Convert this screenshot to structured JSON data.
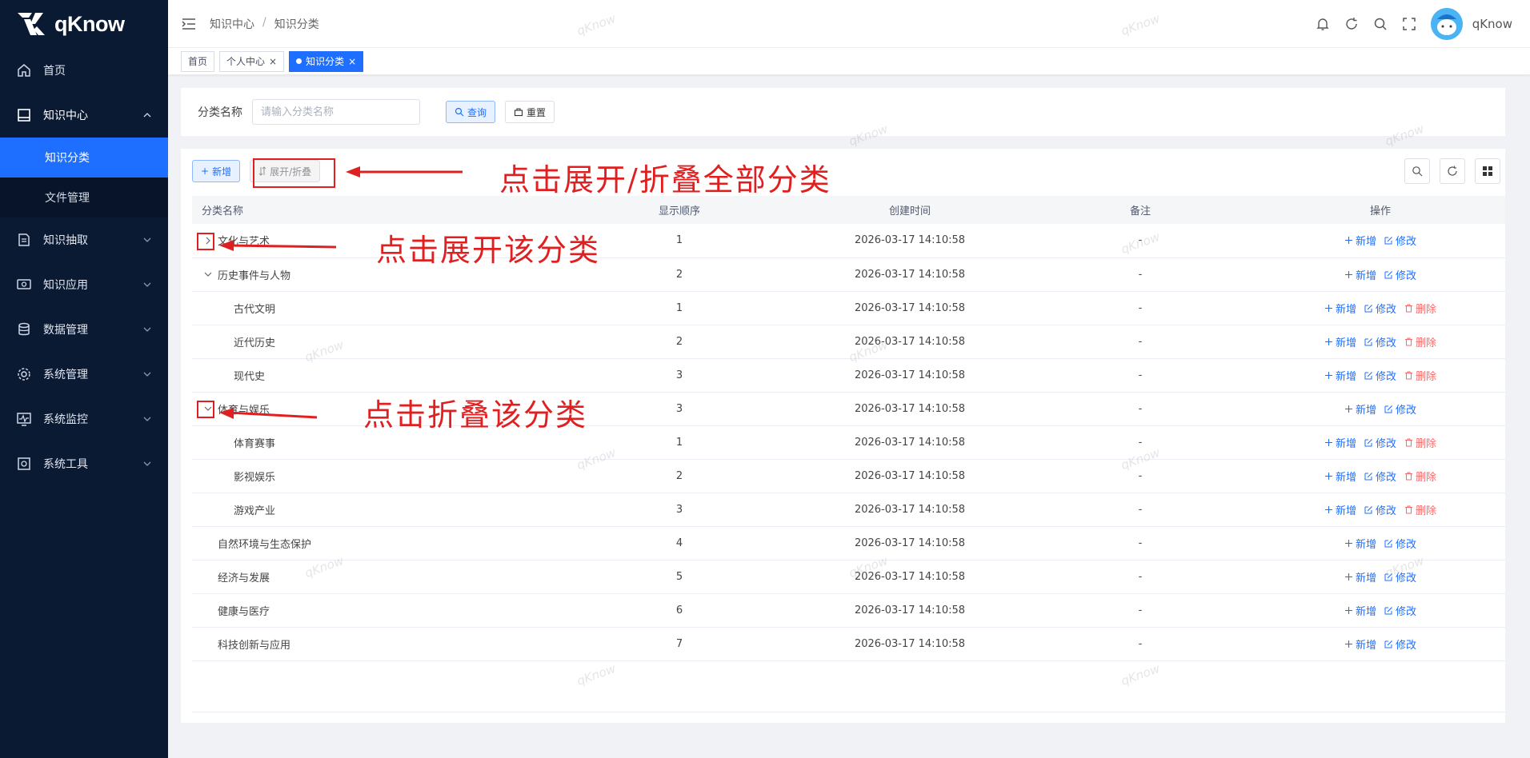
{
  "brand": {
    "name": "qKnow"
  },
  "sidebar": {
    "items": [
      {
        "label": "首页",
        "icon": "home-icon"
      },
      {
        "label": "知识中心",
        "icon": "book-icon",
        "open": true,
        "children": [
          {
            "label": "知识分类",
            "active": true
          },
          {
            "label": "文件管理"
          }
        ]
      },
      {
        "label": "知识抽取",
        "icon": "extract-icon"
      },
      {
        "label": "知识应用",
        "icon": "app-icon"
      },
      {
        "label": "数据管理",
        "icon": "database-icon"
      },
      {
        "label": "系统管理",
        "icon": "gear-icon"
      },
      {
        "label": "系统监控",
        "icon": "monitor-icon"
      },
      {
        "label": "系统工具",
        "icon": "tool-icon"
      }
    ]
  },
  "header": {
    "breadcrumb": [
      "知识中心",
      "知识分类"
    ],
    "user": "qKnow"
  },
  "tags": [
    {
      "label": "首页",
      "closable": false
    },
    {
      "label": "个人中心",
      "closable": true
    },
    {
      "label": "知识分类",
      "closable": true,
      "active": true
    }
  ],
  "search": {
    "label": "分类名称",
    "placeholder": "请输入分类名称",
    "query_label": "查询",
    "reset_label": "重置"
  },
  "toolbar": {
    "add_label": "新增",
    "toggle_label": "展开/折叠"
  },
  "table": {
    "columns": [
      "分类名称",
      "显示顺序",
      "创建时间",
      "备注",
      "操作"
    ],
    "ops": {
      "add": "新增",
      "edit": "修改",
      "del": "删除"
    },
    "rows": [
      {
        "name": "文化与艺术",
        "order": "1",
        "time": "2026-03-17 14:10:58",
        "remark": "-",
        "level": 0,
        "expander": "collapsed",
        "del": false
      },
      {
        "name": "历史事件与人物",
        "order": "2",
        "time": "2026-03-17 14:10:58",
        "remark": "-",
        "level": 0,
        "expander": "expanded",
        "del": false
      },
      {
        "name": "古代文明",
        "order": "1",
        "time": "2026-03-17 14:10:58",
        "remark": "-",
        "level": 1,
        "expander": "none",
        "del": true
      },
      {
        "name": "近代历史",
        "order": "2",
        "time": "2026-03-17 14:10:58",
        "remark": "-",
        "level": 1,
        "expander": "none",
        "del": true
      },
      {
        "name": "现代史",
        "order": "3",
        "time": "2026-03-17 14:10:58",
        "remark": "-",
        "level": 1,
        "expander": "none",
        "del": true
      },
      {
        "name": "体育与娱乐",
        "order": "3",
        "time": "2026-03-17 14:10:58",
        "remark": "-",
        "level": 0,
        "expander": "expanded",
        "del": false
      },
      {
        "name": "体育赛事",
        "order": "1",
        "time": "2026-03-17 14:10:58",
        "remark": "-",
        "level": 1,
        "expander": "none",
        "del": true
      },
      {
        "name": "影视娱乐",
        "order": "2",
        "time": "2026-03-17 14:10:58",
        "remark": "-",
        "level": 1,
        "expander": "none",
        "del": true
      },
      {
        "name": "游戏产业",
        "order": "3",
        "time": "2026-03-17 14:10:58",
        "remark": "-",
        "level": 1,
        "expander": "none",
        "del": true
      },
      {
        "name": "自然环境与生态保护",
        "order": "4",
        "time": "2026-03-17 14:10:58",
        "remark": "-",
        "level": 0,
        "expander": "leaf",
        "del": false
      },
      {
        "name": "经济与发展",
        "order": "5",
        "time": "2026-03-17 14:10:58",
        "remark": "-",
        "level": 0,
        "expander": "leaf",
        "del": false
      },
      {
        "name": "健康与医疗",
        "order": "6",
        "time": "2026-03-17 14:10:58",
        "remark": "-",
        "level": 0,
        "expander": "leaf",
        "del": false
      },
      {
        "name": "科技创新与应用",
        "order": "7",
        "time": "2026-03-17 14:10:58",
        "remark": "-",
        "level": 0,
        "expander": "leaf",
        "del": false
      }
    ]
  },
  "annotations": {
    "toggle_all": "点击展开/折叠全部分类",
    "expand_one": "点击展开该分类",
    "collapse_one": "点击折叠该分类"
  },
  "watermark": "qKnow",
  "colors": {
    "primary": "#1e6fff",
    "sidebar_bg": "#0b1a33",
    "danger": "#f56c6c",
    "annotation": "#e02020"
  }
}
